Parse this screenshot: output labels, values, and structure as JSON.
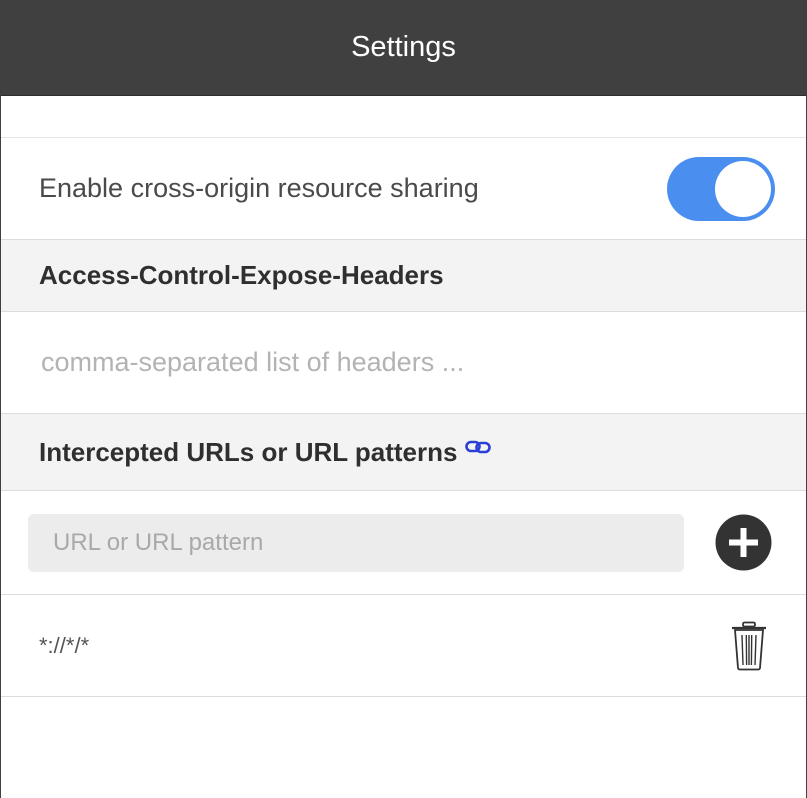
{
  "header": {
    "title": "Settings"
  },
  "cors": {
    "label": "Enable cross-origin resource sharing",
    "enabled": true,
    "toggle_color": "#4a8ff0"
  },
  "expose_headers": {
    "heading": "Access-Control-Expose-Headers",
    "value": "",
    "placeholder": "comma-separated list of headers ..."
  },
  "intercepted": {
    "heading": "Intercepted URLs or URL patterns",
    "heading_icon": "link-icon",
    "input_value": "",
    "input_placeholder": "URL or URL pattern",
    "add_icon": "plus-circle-icon",
    "patterns": [
      {
        "value": "*://*/*",
        "action_icon": "trash-icon"
      }
    ]
  },
  "colors": {
    "header_bg": "#404040",
    "section_bg": "#f3f3f3",
    "accent": "#4a8ff0",
    "link_icon": "#2a3fd6"
  }
}
